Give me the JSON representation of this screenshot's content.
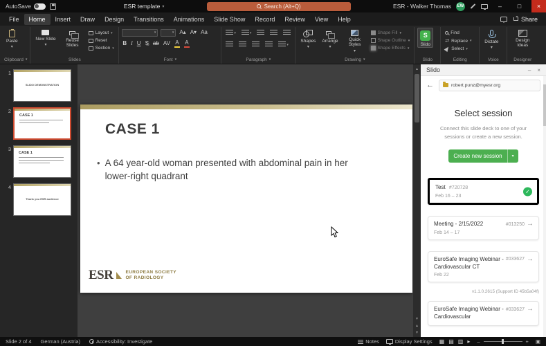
{
  "titlebar": {
    "autosave_label": "AutoSave",
    "title": "ESR template",
    "search_placeholder": "Search (Alt+Q)",
    "user_name": "ESR - Walker Thomas",
    "avatar_initials": "EW"
  },
  "menubar": {
    "items": [
      "File",
      "Home",
      "Insert",
      "Draw",
      "Design",
      "Transitions",
      "Animations",
      "Slide Show",
      "Record",
      "Review",
      "View",
      "Help"
    ],
    "share_label": "Share"
  },
  "ribbon": {
    "paste": "Paste",
    "new_slide": "New Slide",
    "reuse_slides": "Reuse Slides",
    "layout": "Layout",
    "reset": "Reset",
    "section": "Section",
    "bold": "B",
    "italic": "I",
    "underline": "U",
    "shadow": "S",
    "strike": "ab",
    "char_spacing": "AV",
    "change_case": "Aa",
    "highlight": "A",
    "font_color": "A",
    "shapes": "Shapes",
    "arrange": "Arrange",
    "quick_styles": "Quick Styles",
    "shape_fill": "Shape Fill",
    "shape_outline": "Shape Outline",
    "shape_effects": "Shape Effects",
    "slido": "Slido",
    "slido_icon_letter": "S",
    "find": "Find",
    "replace": "Replace",
    "select": "Select",
    "dictate": "Dictate",
    "design_ideas": "Design Ideas",
    "groups": {
      "clipboard": "Clipboard",
      "slides": "Slides",
      "font": "Font",
      "paragraph": "Paragraph",
      "drawing": "Drawing",
      "slido": "Slido",
      "editing": "Editing",
      "voice": "Voice",
      "designer": "Designer"
    }
  },
  "thumbnails": [
    {
      "number": "1",
      "title": "SLIDO DEMONSTRATION"
    },
    {
      "number": "2",
      "title": "CASE 1"
    },
    {
      "number": "3",
      "title": "CASE 1"
    },
    {
      "number": "4",
      "title": "Thank you ESR audience"
    }
  ],
  "slide": {
    "title": "CASE 1",
    "bullet_text": "A 64 year-old woman presented with abdominal pain in her lower-right quadrant",
    "logo_acronym": "ESR",
    "logo_caption_line1": "EUROPEAN SOCIETY",
    "logo_caption_line2": "OF RADIOLOGY"
  },
  "slido_panel": {
    "title": "Slido",
    "account_email": "robert.punz@myesr.org",
    "heading": "Select session",
    "description": "Connect this slide deck to one of your sessions or create a new session.",
    "create_button": "Create new session",
    "sessions": [
      {
        "name": "Test",
        "code": "#720728",
        "dates": "Feb 16 – 23"
      },
      {
        "name": "Meeting - 2/15/2022",
        "code": "#013250",
        "dates": "Feb 14 – 17"
      },
      {
        "name": "EuroSafe Imaging Webinar - Cardiovascular CT",
        "code": "#033627",
        "dates": "Feb 22"
      },
      {
        "name": "EuroSafe Imaging Webinar - Cardiovascular",
        "code": "#033627",
        "dates": ""
      }
    ],
    "version": "v1.1.0.2615 (Support ID 45b5a04f)"
  },
  "statusbar": {
    "slide_info": "Slide 2 of 4",
    "language": "German (Austria)",
    "accessibility": "Accessibility: Investigate",
    "notes": "Notes",
    "display_settings": "Display Settings"
  },
  "icons": {
    "chevron_down": "▾",
    "back_arrow": "←",
    "forward_arrow": "→",
    "check": "✓",
    "close": "×",
    "minimize": "–",
    "restore": "□",
    "bullet": "•",
    "scroll_up": "▴",
    "scroll_down": "▾",
    "swap": "⇄",
    "view_normal": "▦",
    "view_sorter": "▤",
    "view_reading": "▥",
    "view_slideshow": "▸",
    "zoom_out": "–",
    "zoom_in": "+",
    "fit_window": "▣",
    "increase_font": "A▴",
    "decrease_font": "A▾"
  },
  "colors": {
    "search_accent": "#B85C3B",
    "slido_green": "#44B24C",
    "create_button_green": "#4CAF50",
    "check_green": "#2EB85C",
    "selected_slide_border": "#CF4A2F",
    "slide_gold": "#AB9C60",
    "close_button_red": "#C42B1C"
  }
}
